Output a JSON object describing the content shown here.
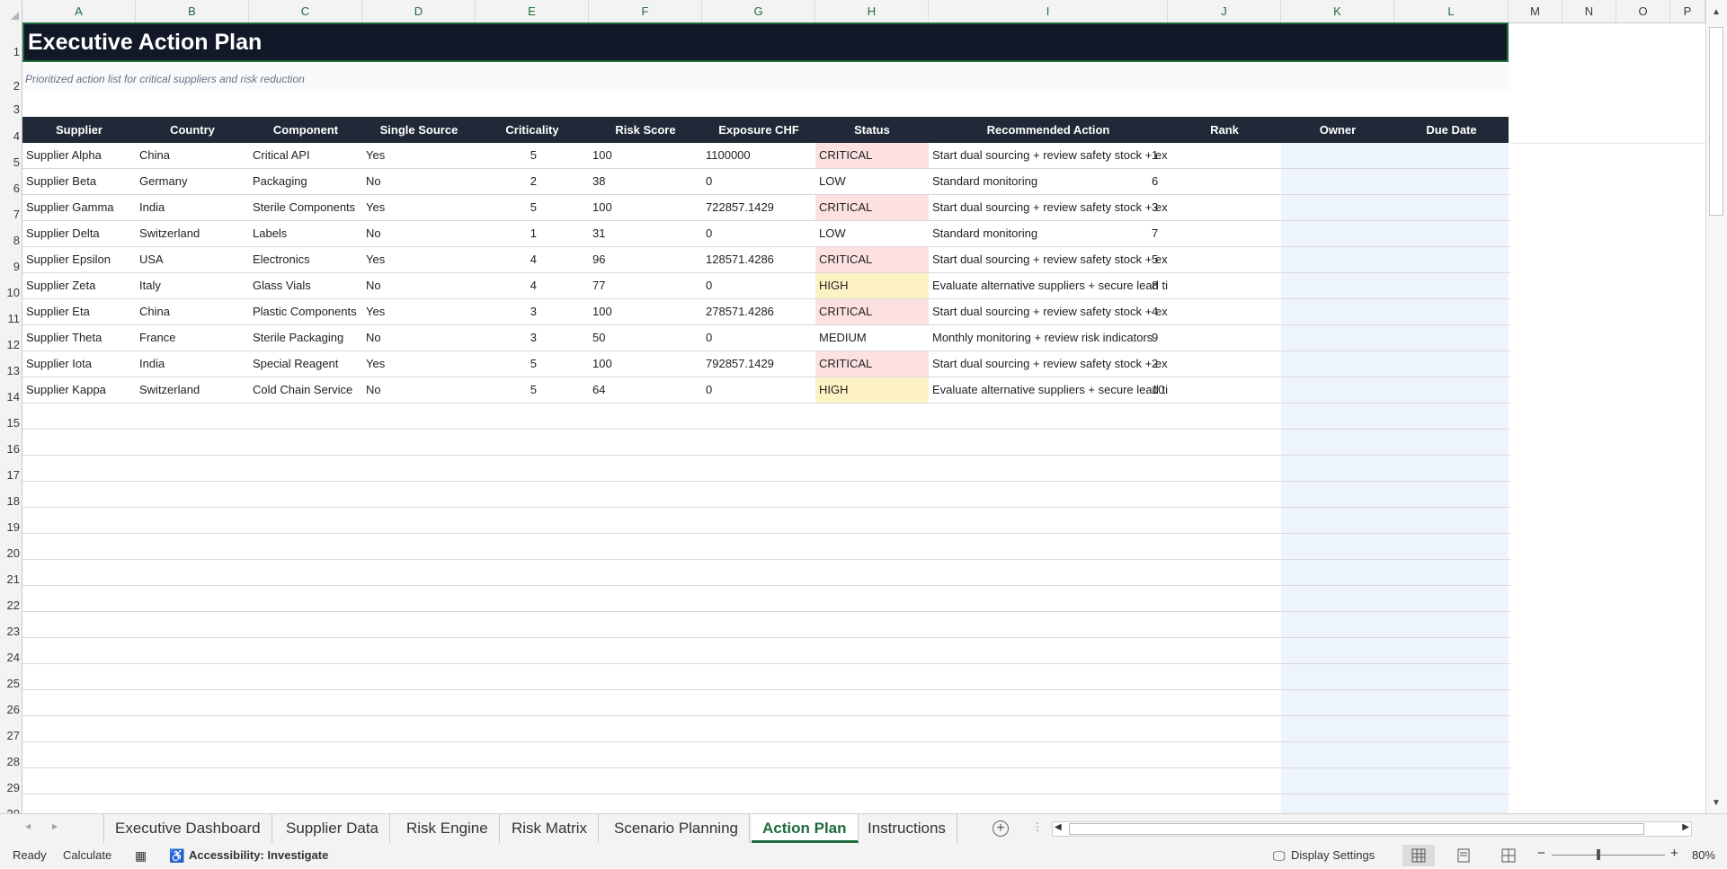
{
  "columns": [
    "A",
    "B",
    "C",
    "D",
    "E",
    "F",
    "G",
    "H",
    "I",
    "J",
    "K",
    "L",
    "M",
    "N",
    "O",
    "P"
  ],
  "rows": [
    "1",
    "2",
    "3",
    "4",
    "5",
    "6",
    "7",
    "8",
    "9",
    "10",
    "11",
    "12",
    "13",
    "14",
    "15",
    "16",
    "17",
    "18",
    "19",
    "20",
    "21",
    "22",
    "23",
    "24",
    "25",
    "26",
    "27",
    "28",
    "29",
    "30"
  ],
  "sheet": {
    "title": "Executive Action Plan",
    "subtitle": "Prioritized action list for critical suppliers and risk reduction",
    "headers": [
      "Supplier",
      "Country",
      "Component",
      "Single Source",
      "Criticality",
      "Risk Score",
      "Exposure CHF",
      "Status",
      "Recommended Action",
      "Rank",
      "Owner",
      "Due Date"
    ],
    "rows": [
      [
        "Supplier Alpha",
        "China",
        "Critical API",
        "Yes",
        "5",
        "100",
        "1100000",
        "CRITICAL",
        "Start dual sourcing + review safety stock + exec",
        "1"
      ],
      [
        "Supplier Beta",
        "Germany",
        "Packaging",
        "No",
        "2",
        "38",
        "0",
        "LOW",
        "Standard monitoring",
        "6"
      ],
      [
        "Supplier Gamma",
        "India",
        "Sterile Components",
        "Yes",
        "5",
        "100",
        "722857.1429",
        "CRITICAL",
        "Start dual sourcing + review safety stock + exec",
        "3"
      ],
      [
        "Supplier Delta",
        "Switzerland",
        "Labels",
        "No",
        "1",
        "31",
        "0",
        "LOW",
        "Standard monitoring",
        "7"
      ],
      [
        "Supplier Epsilon",
        "USA",
        "Electronics",
        "Yes",
        "4",
        "96",
        "128571.4286",
        "CRITICAL",
        "Start dual sourcing + review safety stock + exec",
        "5"
      ],
      [
        "Supplier Zeta",
        "Italy",
        "Glass Vials",
        "No",
        "4",
        "77",
        "0",
        "HIGH",
        "Evaluate alternative suppliers + secure lead tim",
        "8"
      ],
      [
        "Supplier Eta",
        "China",
        "Plastic Components",
        "Yes",
        "3",
        "100",
        "278571.4286",
        "CRITICAL",
        "Start dual sourcing + review safety stock + exec",
        "4"
      ],
      [
        "Supplier Theta",
        "France",
        "Sterile Packaging",
        "No",
        "3",
        "50",
        "0",
        "MEDIUM",
        "Monthly monitoring + review risk indicators",
        "9"
      ],
      [
        "Supplier Iota",
        "India",
        "Special Reagent",
        "Yes",
        "5",
        "100",
        "792857.1429",
        "CRITICAL",
        "Start dual sourcing + review safety stock + exec",
        "2"
      ],
      [
        "Supplier Kappa",
        "Switzerland",
        "Cold Chain Service",
        "No",
        "5",
        "64",
        "0",
        "HIGH",
        "Evaluate alternative suppliers + secure lead tim",
        "10"
      ]
    ]
  },
  "tabs": [
    "Executive Dashboard",
    "Supplier Data",
    "Risk Engine",
    "Risk Matrix",
    "Scenario Planning",
    "Action Plan",
    "Instructions"
  ],
  "active_tab": "Action Plan",
  "status": {
    "ready": "Ready",
    "calculate": "Calculate",
    "accessibility": "Accessibility: Investigate",
    "display_settings": "Display Settings",
    "zoom": "80%"
  },
  "colors": {
    "title_bg": "#111827",
    "header_bg": "#1f2937",
    "critical": "#fde1e1",
    "high": "#fdf2c4",
    "owner_band": "#eef4fc",
    "accent": "#1e6b3d"
  }
}
